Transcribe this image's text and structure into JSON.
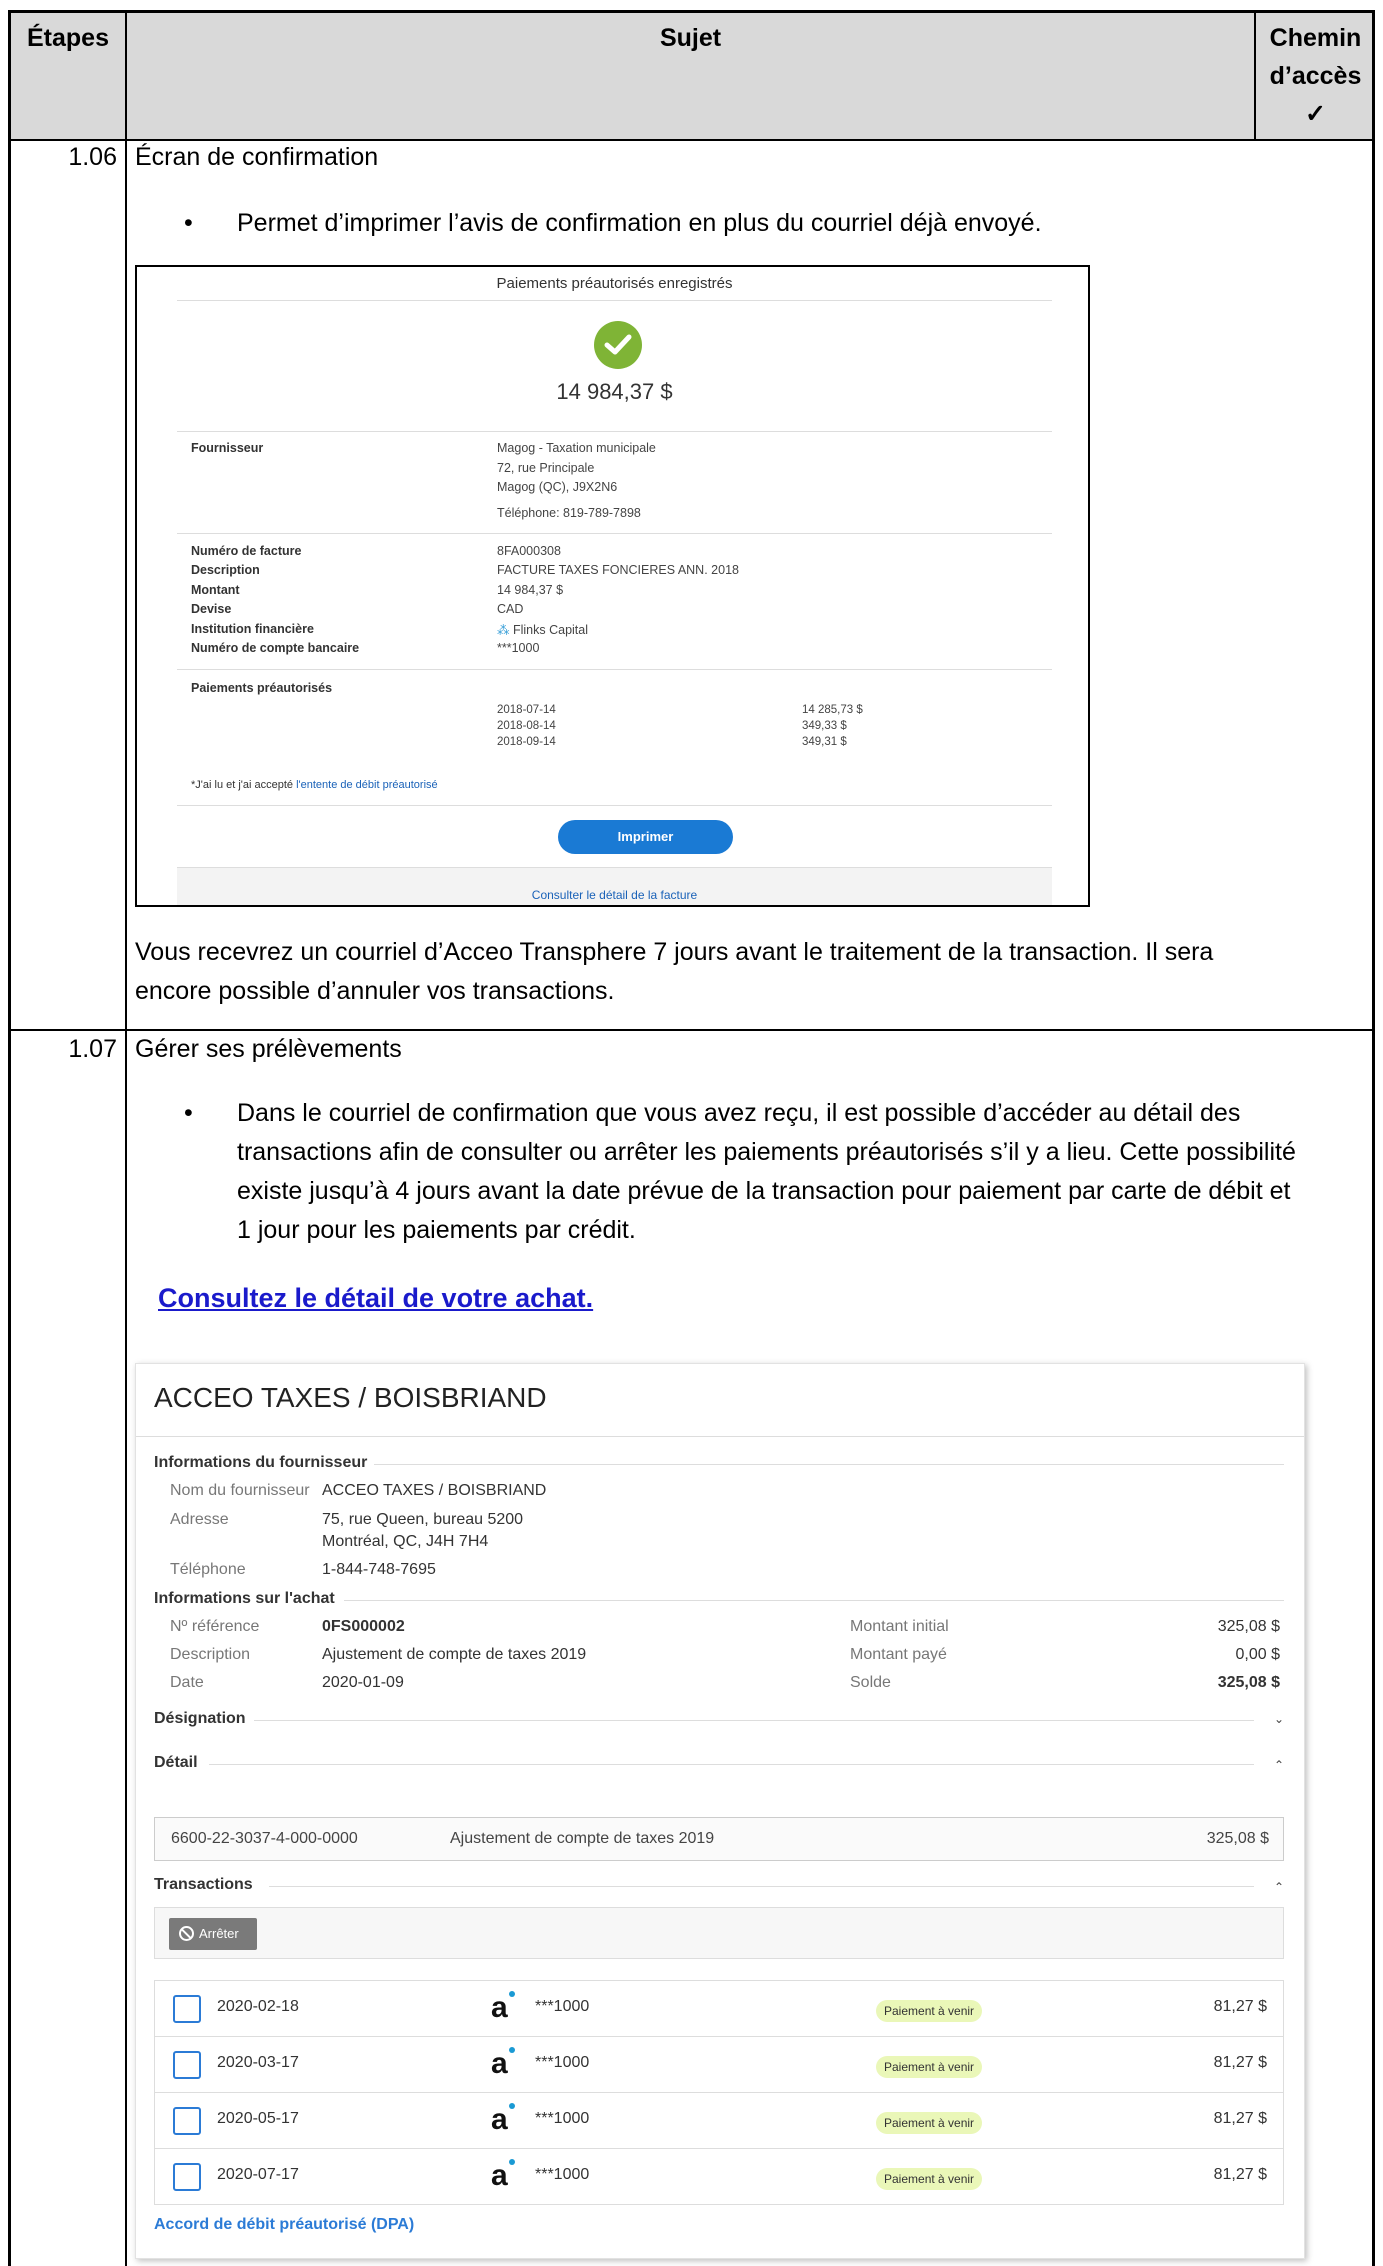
{
  "header": {
    "col_steps": "Étapes",
    "col_subject": "Sujet",
    "col_path_line1": "Chemin",
    "col_path_line2": "d’accès",
    "col_path_check": "✓"
  },
  "section_106": {
    "step": "1.06",
    "title": "Écran de confirmation",
    "bullet": "Permet d’imprimer l’avis de confirmation en plus du courriel déjà envoyé.",
    "paragraph_line1": "Vous recevrez un courriel d’Acceo Transphere 7 jours avant le traitement de la transaction. Il sera",
    "paragraph_line2": "encore possible d’annuler vos transactions."
  },
  "confirmation": {
    "top_title": "Paiements préautorisés enregistrés",
    "amount": "14 984,37 $",
    "supplier_label": "Fournisseur",
    "supplier_lines": [
      "Magog - Taxation municipale",
      "72, rue Principale",
      "Magog (QC), J9X2N6"
    ],
    "supplier_phone": "Téléphone: 819-789-7898",
    "invoice": {
      "labels": [
        "Numéro de facture",
        "Description",
        "Montant",
        "Devise",
        "Institution financière",
        "Numéro de compte bancaire"
      ],
      "values": [
        "8FA000308",
        "FACTURE TAXES FONCIERES ANN. 2018",
        "14 984,37 $",
        "CAD",
        "Flinks Capital",
        "***1000"
      ]
    },
    "preauth_label": "Paiements préautorisés",
    "preauth": [
      {
        "date": "2018-07-14",
        "amount": "14 285,73 $"
      },
      {
        "date": "2018-08-14",
        "amount": "349,33 $"
      },
      {
        "date": "2018-09-14",
        "amount": "349,31 $"
      }
    ],
    "note_prefix": "*J'ai lu et j'ai accepté ",
    "note_link": "l'entente de débit préautorisé",
    "print_button": "Imprimer",
    "footer_link": "Consulter le détail de la facture"
  },
  "section_107": {
    "step": "1.07",
    "title": "Gérer ses prélèvements",
    "bullet_lines": [
      "Dans le courriel de confirmation que vous avez reçu, il est possible d’accéder au détail des",
      "transactions afin de consulter ou arrêter les paiements préautorisés s’il y a lieu. Cette possibilité",
      "existe jusqu’à 4 jours avant la date prévue de la transaction pour paiement par carte de débit et",
      "1 jour pour les paiements par crédit."
    ],
    "link": "Consultez le détail de votre achat."
  },
  "acceo": {
    "title": "ACCEO TAXES / BOISBRIAND",
    "supplier_section": "Informations du fournisseur",
    "supplier_name_label": "Nom du fournisseur",
    "supplier_name": "ACCEO TAXES / BOISBRIAND",
    "address_label": "Adresse",
    "address_line1": "75, rue Queen, bureau 5200",
    "address_line2": "Montréal, QC, J4H 7H4",
    "phone_label": "Téléphone",
    "phone": "1-844-748-7695",
    "purchase_section": "Informations sur l'achat",
    "ref_label": "Nº référence",
    "ref": "0FS000002",
    "desc_label": "Description",
    "desc": "Ajustement de compte de taxes 2019",
    "date_label": "Date",
    "date": "2020-01-09",
    "initial_label": "Montant initial",
    "initial": "325,08 $",
    "paid_label": "Montant payé",
    "paid": "0,00 $",
    "balance_label": "Solde",
    "balance": "325,08 $",
    "designation_section": "Désignation",
    "detail_section": "Détail",
    "detail_row": {
      "account": "6600-22-3037-4-000-0000",
      "description": "Ajustement de compte de taxes 2019",
      "amount": "325,08 $"
    },
    "transactions_section": "Transactions",
    "stop_button": "Arrêter",
    "transactions": [
      {
        "date": "2020-02-18",
        "account": "***1000",
        "status": "Paiement à venir",
        "amount": "81,27 $"
      },
      {
        "date": "2020-03-17",
        "account": "***1000",
        "status": "Paiement à venir",
        "amount": "81,27 $"
      },
      {
        "date": "2020-05-17",
        "account": "***1000",
        "status": "Paiement à venir",
        "amount": "81,27 $"
      },
      {
        "date": "2020-07-17",
        "account": "***1000",
        "status": "Paiement à venir",
        "amount": "81,27 $"
      }
    ],
    "dpa_link": "Accord de débit préautorisé (DPA)"
  }
}
